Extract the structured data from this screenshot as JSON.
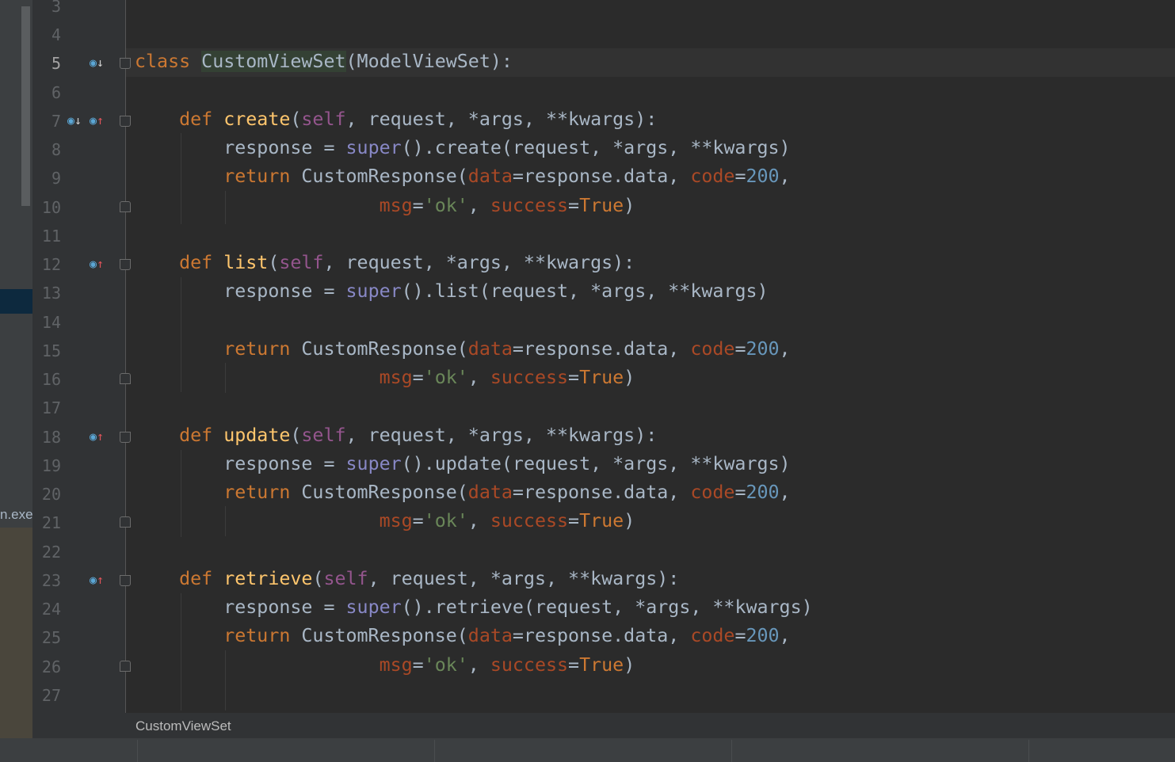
{
  "editor": {
    "line_numbers": [
      "3",
      "4",
      "5",
      "6",
      "7",
      "8",
      "9",
      "10",
      "11",
      "12",
      "13",
      "14",
      "15",
      "16",
      "17",
      "18",
      "19",
      "20",
      "21",
      "22",
      "23",
      "24",
      "25",
      "26",
      "27"
    ],
    "current_line": "5"
  },
  "code": {
    "class_kw": "class",
    "class_name": "CustomViewSet",
    "class_base": "(ModelViewSet):",
    "def_kw": "def",
    "return_kw": "return",
    "self_kw": "self",
    "super_kw": "super",
    "methods": [
      "create",
      "list",
      "update",
      "retrieve"
    ],
    "params_tail": ", request, *args, **kwargs):",
    "response_assign": "response = ",
    "call_args": "(request, *args, **kwargs)",
    "custom_response": "CustomResponse(",
    "data_kw": "data",
    "data_val": "=response.data, ",
    "code_kw": "code",
    "code_val": "200",
    "msg_kw": "msg",
    "msg_val": "'ok'",
    "success_kw": "success",
    "true_val": "True"
  },
  "left_panel": {
    "exe_label": "n.exe"
  },
  "breadcrumb": {
    "text": "CustomViewSet"
  },
  "colors": {
    "background": "#2b2b2b",
    "keyword": "#cc7832",
    "function": "#ffc66d",
    "self": "#94558d",
    "builtin": "#8888c6",
    "number": "#6897bb",
    "string": "#6a8759",
    "kwarg": "#aa4926"
  },
  "icons": {
    "implemented": "override-down-icon",
    "overrides": "override-up-icon",
    "fold": "fold-marker-icon"
  }
}
